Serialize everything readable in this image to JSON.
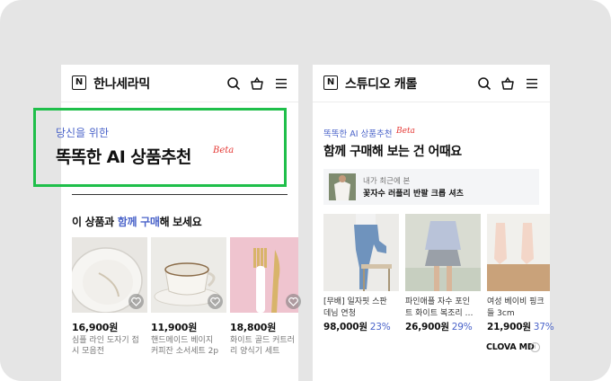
{
  "left_phone": {
    "store_name": "한나세라믹",
    "logo_letter": "N",
    "banner_subtitle": "당신을 위한",
    "banner_title": "똑똑한 AI 상품추천",
    "beta_label": "Beta",
    "section_title_pre": "이 상품과 ",
    "section_title_accent": "함께 구매",
    "section_title_post": "해 보세요",
    "products": [
      {
        "price": "16,900원",
        "name_line1": "심플 라인 도자기 접",
        "name_line2": "시 모음전"
      },
      {
        "price": "11,900원",
        "name_line1": "핸드메이드 베이지",
        "name_line2": "커피잔 소서세트 2p"
      },
      {
        "price": "18,800원",
        "name_line1": "화이트 골드 커트러",
        "name_line2": "리 양식기 세트"
      }
    ]
  },
  "right_phone": {
    "store_name": "스튜디오 캐롤",
    "logo_letter": "N",
    "subtitle": "똑똑한 AI 상품추천",
    "beta_label": "Beta",
    "title": "함께 구매해 보는 건 어때요",
    "recent_label": "내가 최근에 본",
    "recent_name": "꽃자수 러플리 반팔 크롭 셔츠",
    "products": [
      {
        "name_line1": "[무배] 일자핏 스판",
        "name_line2": "데님 연청",
        "price": "98,000원",
        "discount": "23%"
      },
      {
        "name_line1": "파인애플 자수 포인",
        "name_line2": "트 화이트 복조리 …",
        "price": "26,900원",
        "discount": "29%"
      },
      {
        "name_line1": "여성 베이비 핑크 ",
        "name_line2": "들 3cm",
        "price": "21,900원",
        "discount": "37%"
      }
    ],
    "footer_brand": "CLOVA MD",
    "info_glyph": "i"
  },
  "icons": [
    "search-icon",
    "bag-icon",
    "menu-icon",
    "heart-icon",
    "info-icon"
  ],
  "colors": {
    "accent": "#4a63c9",
    "highlight": "#1fbf4a",
    "beta": "#e53935",
    "background": "#e5e5e5"
  }
}
